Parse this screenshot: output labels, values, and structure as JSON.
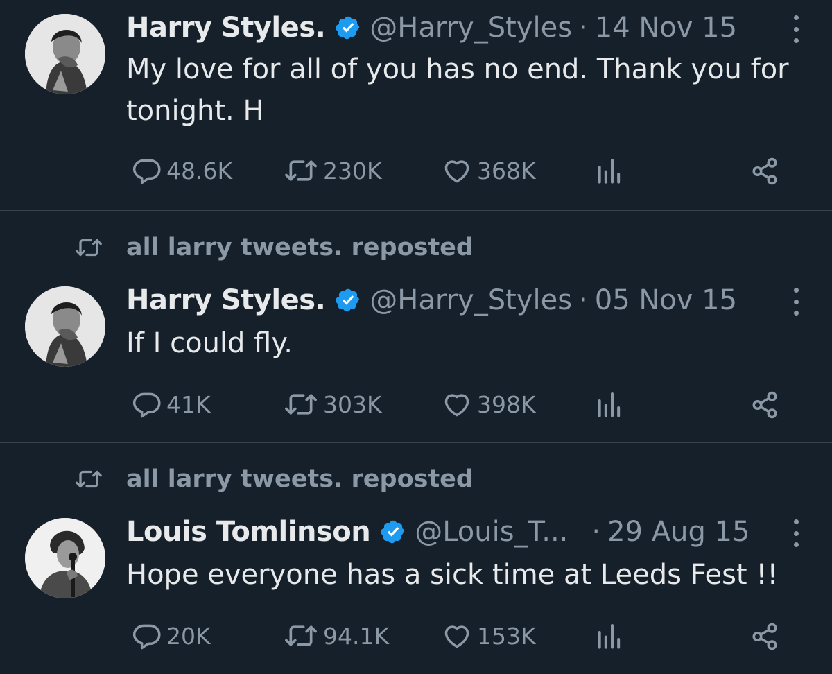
{
  "colors": {
    "background": "#15202b",
    "divider": "#38444d",
    "text_primary": "#e7e9ea",
    "text_secondary": "#8b98a5",
    "verified_badge": "#1d9bf0"
  },
  "icons": {
    "reply": "reply-icon",
    "repost": "repost-icon",
    "like": "heart-icon",
    "views": "views-icon",
    "share": "share-icon",
    "more": "more-icon",
    "verified": "verified-badge-icon"
  },
  "tweets": [
    {
      "social_context": "",
      "author_name": "Harry Styles.",
      "handle": "@Harry_Styles",
      "separator": "·",
      "date": "14 Nov 15",
      "text": "My love for all of you has no end. Thank you for tonight. H",
      "replies": "48.6K",
      "reposts": "230K",
      "likes": "368K"
    },
    {
      "social_context": "all larry tweets. reposted",
      "author_name": "Harry Styles.",
      "handle": "@Harry_Styles",
      "separator": "·",
      "date": "05 Nov 15",
      "text": "If I could fly.",
      "replies": "41K",
      "reposts": "303K",
      "likes": "398K"
    },
    {
      "social_context": "all larry tweets. reposted",
      "author_name": "Louis Tomlinson",
      "handle": "@Louis_T...",
      "separator": "·",
      "date": "29 Aug 15",
      "text": "Hope everyone has a sick time at Leeds Fest !!",
      "replies": "20K",
      "reposts": "94.1K",
      "likes": "153K"
    }
  ]
}
